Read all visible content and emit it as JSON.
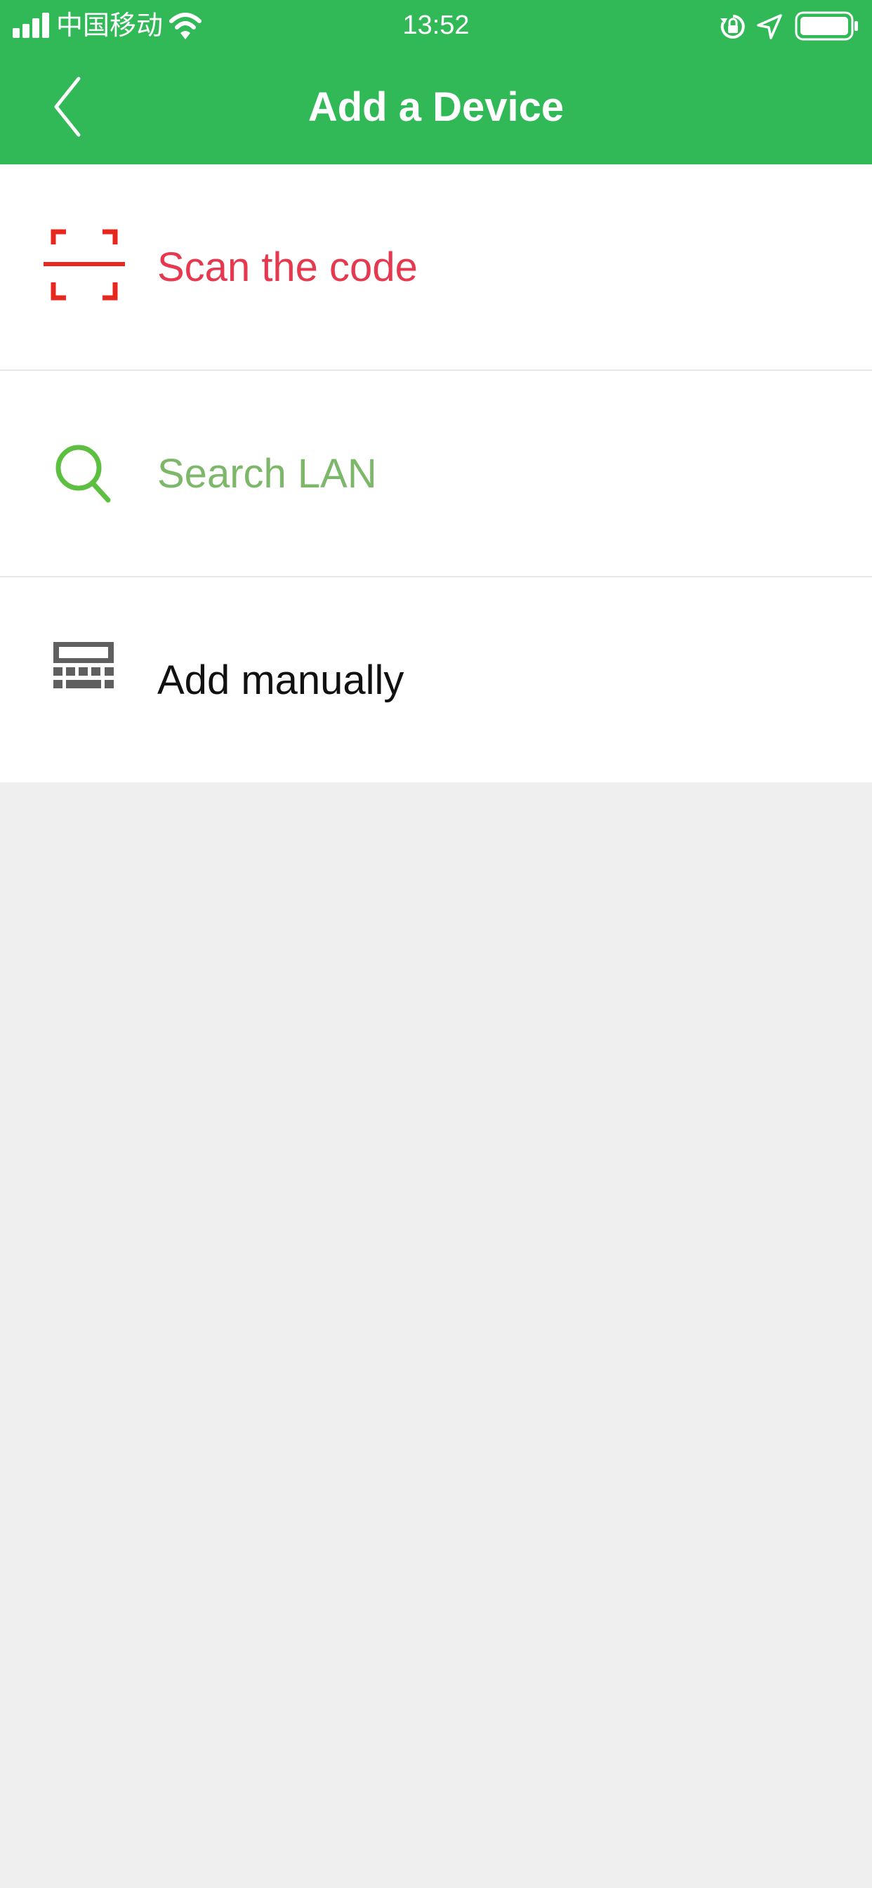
{
  "status_bar": {
    "carrier": "中国移动",
    "time": "13:52",
    "icons": [
      "signal-icon",
      "wifi-icon",
      "rotation-lock-icon",
      "location-icon",
      "battery-icon"
    ]
  },
  "nav": {
    "title": "Add a Device",
    "back_icon": "chevron-left-icon"
  },
  "options": [
    {
      "label": "Scan the code",
      "icon": "scan-code-icon",
      "color": "#e6394f",
      "icon_color": "#e8281e"
    },
    {
      "label": "Search LAN",
      "icon": "search-icon",
      "color": "#7db86a",
      "icon_color": "#5cbf3f"
    },
    {
      "label": "Add manually",
      "icon": "keyboard-icon",
      "color": "#111111",
      "icon_color": "#5f5f5f"
    }
  ],
  "colors": {
    "brand_green": "#31b958",
    "background": "#efefef"
  }
}
